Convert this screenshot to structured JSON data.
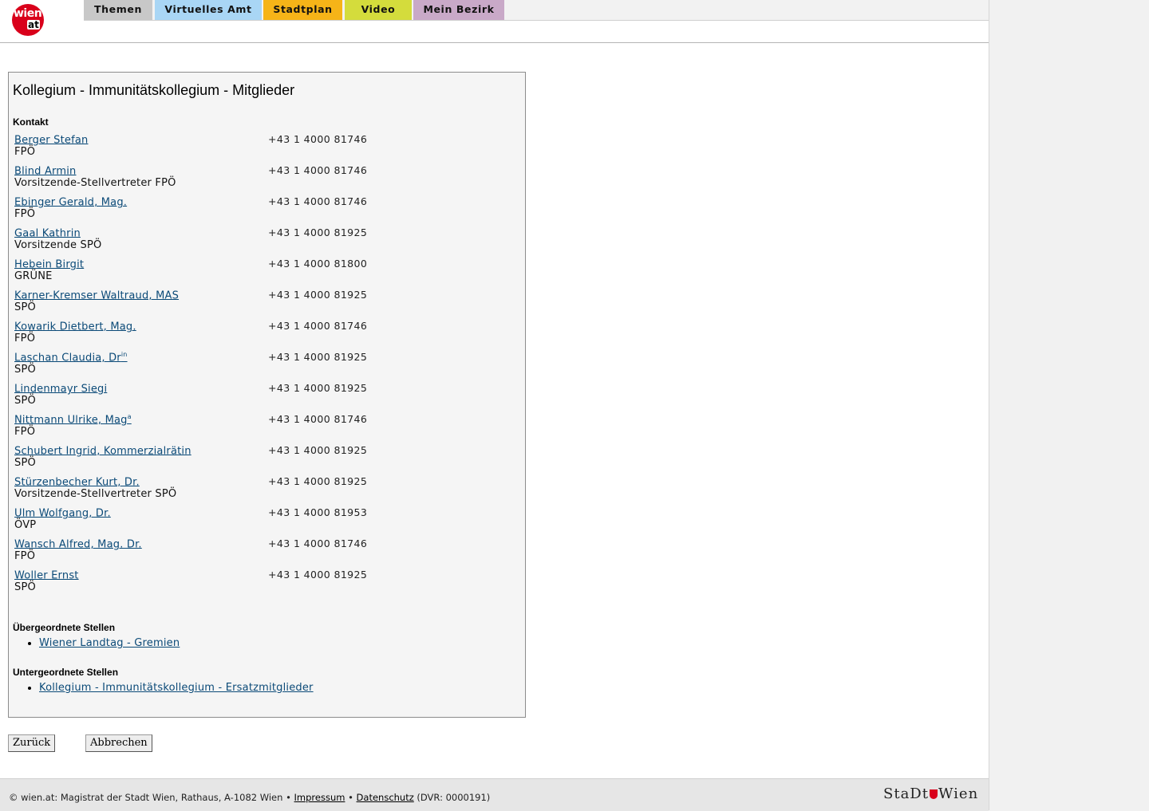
{
  "header": {
    "logo_top": "wien",
    "logo_bottom": "at",
    "nav": [
      {
        "label": "Themen",
        "color": "#c8c8c8"
      },
      {
        "label": "Virtuelles Amt",
        "color": "#a9d6f5"
      },
      {
        "label": "Stadtplan",
        "color": "#f6b418"
      },
      {
        "label": "Video",
        "color": "#d4dc3c"
      },
      {
        "label": "Mein Bezirk",
        "color": "#c9a9c8"
      }
    ]
  },
  "main": {
    "title": "Kollegium - Immunitätskollegium - Mitglieder",
    "contact_heading": "Kontakt",
    "members": [
      {
        "name": "Berger Stefan",
        "sup": "",
        "role": "FPÖ",
        "phone": "+43 1 4000 81746"
      },
      {
        "name": "Blind Armin",
        "sup": "",
        "role": "Vorsitzende-Stellvertreter FPÖ",
        "phone": "+43 1 4000 81746"
      },
      {
        "name": "Ebinger Gerald, Mag.",
        "sup": "",
        "role": "FPÖ",
        "phone": "+43 1 4000 81746"
      },
      {
        "name": "Gaal Kathrin",
        "sup": "",
        "role": "Vorsitzende SPÖ",
        "phone": "+43 1 4000 81925"
      },
      {
        "name": "Hebein Birgit",
        "sup": "",
        "role": "GRÜNE",
        "phone": "+43 1 4000 81800"
      },
      {
        "name": "Karner-Kremser Waltraud, MAS",
        "sup": "",
        "role": "SPÖ",
        "phone": "+43 1 4000 81925"
      },
      {
        "name": "Kowarik Dietbert, Mag.",
        "sup": "",
        "role": "FPÖ",
        "phone": "+43 1 4000 81746"
      },
      {
        "name": "Laschan Claudia, Dr",
        "sup": "in",
        "role": "SPÖ",
        "phone": "+43 1 4000 81925"
      },
      {
        "name": "Lindenmayr Siegi",
        "sup": "",
        "role": "SPÖ",
        "phone": "+43 1 4000 81925"
      },
      {
        "name": "Nittmann Ulrike, Mag",
        "sup": "a",
        "role": "FPÖ",
        "phone": "+43 1 4000 81746"
      },
      {
        "name": "Schubert Ingrid, Kommerzialrätin",
        "sup": "",
        "role": "SPÖ",
        "phone": "+43 1 4000 81925"
      },
      {
        "name": "Stürzenbecher Kurt, Dr.",
        "sup": "",
        "role": "Vorsitzende-Stellvertreter SPÖ",
        "phone": "+43 1 4000 81925"
      },
      {
        "name": "Ulm Wolfgang, Dr.",
        "sup": "",
        "role": "ÖVP",
        "phone": "+43 1 4000 81953"
      },
      {
        "name": "Wansch Alfred, Mag. Dr.",
        "sup": "",
        "role": "FPÖ",
        "phone": "+43 1 4000 81746"
      },
      {
        "name": "Woller Ernst",
        "sup": "",
        "role": "SPÖ",
        "phone": "+43 1 4000 81925"
      }
    ],
    "parent_heading": "Übergeordnete Stellen",
    "parent_link": "Wiener Landtag - Gremien",
    "child_heading": "Untergeordnete Stellen",
    "child_link": "Kollegium - Immunitätskollegium - Ersatzmitglieder"
  },
  "buttons": {
    "back": "Zurück",
    "cancel": "Abbrechen"
  },
  "footer": {
    "text_prefix": "© wien.at: Magistrat der Stadt Wien, Rathaus, A-1082 Wien •",
    "impressum": "Impressum",
    "separator": "•",
    "datenschutz": "Datenschutz",
    "dvr": "(DVR: 0000191)",
    "logo_left": "StaDt",
    "logo_right": "Wien"
  }
}
